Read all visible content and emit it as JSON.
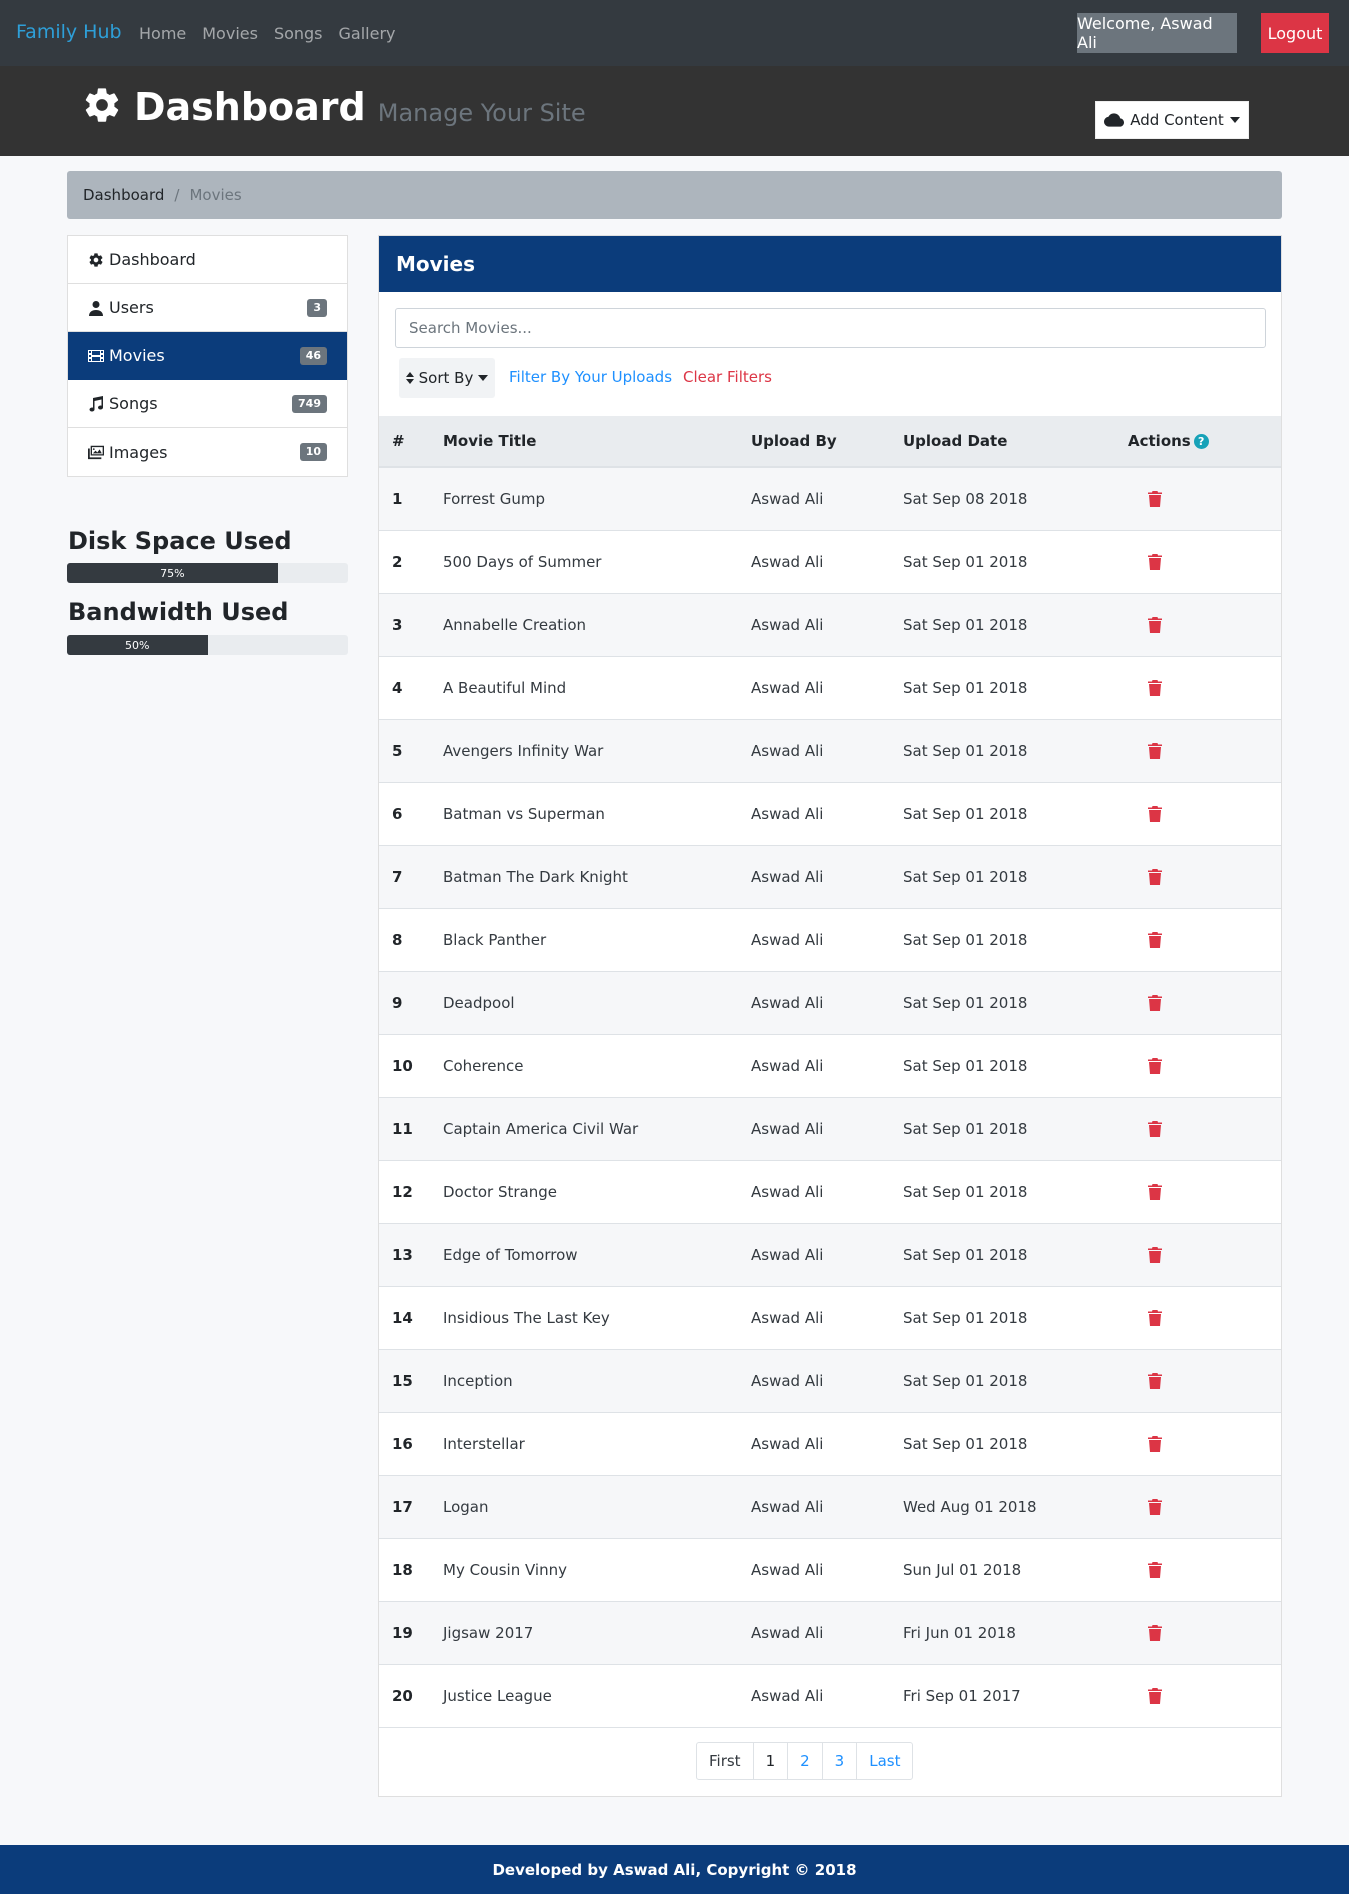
{
  "navbar": {
    "brand": "Family Hub",
    "links": [
      "Home",
      "Movies",
      "Songs",
      "Gallery"
    ],
    "welcome": "Welcome, Aswad Ali",
    "logout": "Logout"
  },
  "header": {
    "title": "Dashboard",
    "subtitle": "Manage Your Site",
    "add_content": "Add Content"
  },
  "breadcrumb": [
    "Dashboard",
    "Movies"
  ],
  "sidebar": {
    "items": [
      {
        "label": "Dashboard",
        "icon": "gear-icon",
        "badge": ""
      },
      {
        "label": "Users",
        "icon": "user-icon",
        "badge": "3"
      },
      {
        "label": "Movies",
        "icon": "film-icon",
        "badge": "46"
      },
      {
        "label": "Songs",
        "icon": "music-icon",
        "badge": "749"
      },
      {
        "label": "Images",
        "icon": "images-icon",
        "badge": "10"
      }
    ]
  },
  "stats": {
    "disk": {
      "title": "Disk Space Used",
      "label": "75%",
      "value": 0.75
    },
    "bandwidth": {
      "title": "Bandwidth Used",
      "label": "50%",
      "value": 0.5
    }
  },
  "movies": {
    "title": "Movies",
    "search_placeholder": "Search Movies...",
    "sort_by": "Sort By",
    "filter_uploads": "Filter By Your Uploads",
    "clear_filters": "Clear Filters",
    "columns": [
      "#",
      "Movie Title",
      "Upload By",
      "Upload Date",
      "Actions"
    ],
    "rows": [
      [
        "1",
        "Forrest Gump",
        "Aswad Ali",
        "Sat Sep 08 2018"
      ],
      [
        "2",
        "500 Days of Summer",
        "Aswad Ali",
        "Sat Sep 01 2018"
      ],
      [
        "3",
        "Annabelle Creation",
        "Aswad Ali",
        "Sat Sep 01 2018"
      ],
      [
        "4",
        "A Beautiful Mind",
        "Aswad Ali",
        "Sat Sep 01 2018"
      ],
      [
        "5",
        "Avengers Infinity War",
        "Aswad Ali",
        "Sat Sep 01 2018"
      ],
      [
        "6",
        "Batman vs Superman",
        "Aswad Ali",
        "Sat Sep 01 2018"
      ],
      [
        "7",
        "Batman The Dark Knight",
        "Aswad Ali",
        "Sat Sep 01 2018"
      ],
      [
        "8",
        "Black Panther",
        "Aswad Ali",
        "Sat Sep 01 2018"
      ],
      [
        "9",
        "Deadpool",
        "Aswad Ali",
        "Sat Sep 01 2018"
      ],
      [
        "10",
        "Coherence",
        "Aswad Ali",
        "Sat Sep 01 2018"
      ],
      [
        "11",
        "Captain America Civil War",
        "Aswad Ali",
        "Sat Sep 01 2018"
      ],
      [
        "12",
        "Doctor Strange",
        "Aswad Ali",
        "Sat Sep 01 2018"
      ],
      [
        "13",
        "Edge of Tomorrow",
        "Aswad Ali",
        "Sat Sep 01 2018"
      ],
      [
        "14",
        "Insidious The Last Key",
        "Aswad Ali",
        "Sat Sep 01 2018"
      ],
      [
        "15",
        "Inception",
        "Aswad Ali",
        "Sat Sep 01 2018"
      ],
      [
        "16",
        "Interstellar",
        "Aswad Ali",
        "Sat Sep 01 2018"
      ],
      [
        "17",
        "Logan",
        "Aswad Ali",
        "Wed Aug 01 2018"
      ],
      [
        "18",
        "My Cousin Vinny",
        "Aswad Ali",
        "Sun Jul 01 2018"
      ],
      [
        "19",
        "Jigsaw 2017",
        "Aswad Ali",
        "Fri Jun 01 2018"
      ],
      [
        "20",
        "Justice League",
        "Aswad Ali",
        "Fri Sep 01 2017"
      ]
    ],
    "pagination": [
      "First",
      "1",
      "2",
      "3",
      "Last"
    ]
  },
  "footer": "Developed by Aswad Ali, Copyright © 2018",
  "colors": {
    "navbar": "#343a40",
    "brand": "#2e9fd8",
    "primary": "#0b3c7b",
    "danger": "#dc3545",
    "link": "#1e90ff"
  }
}
